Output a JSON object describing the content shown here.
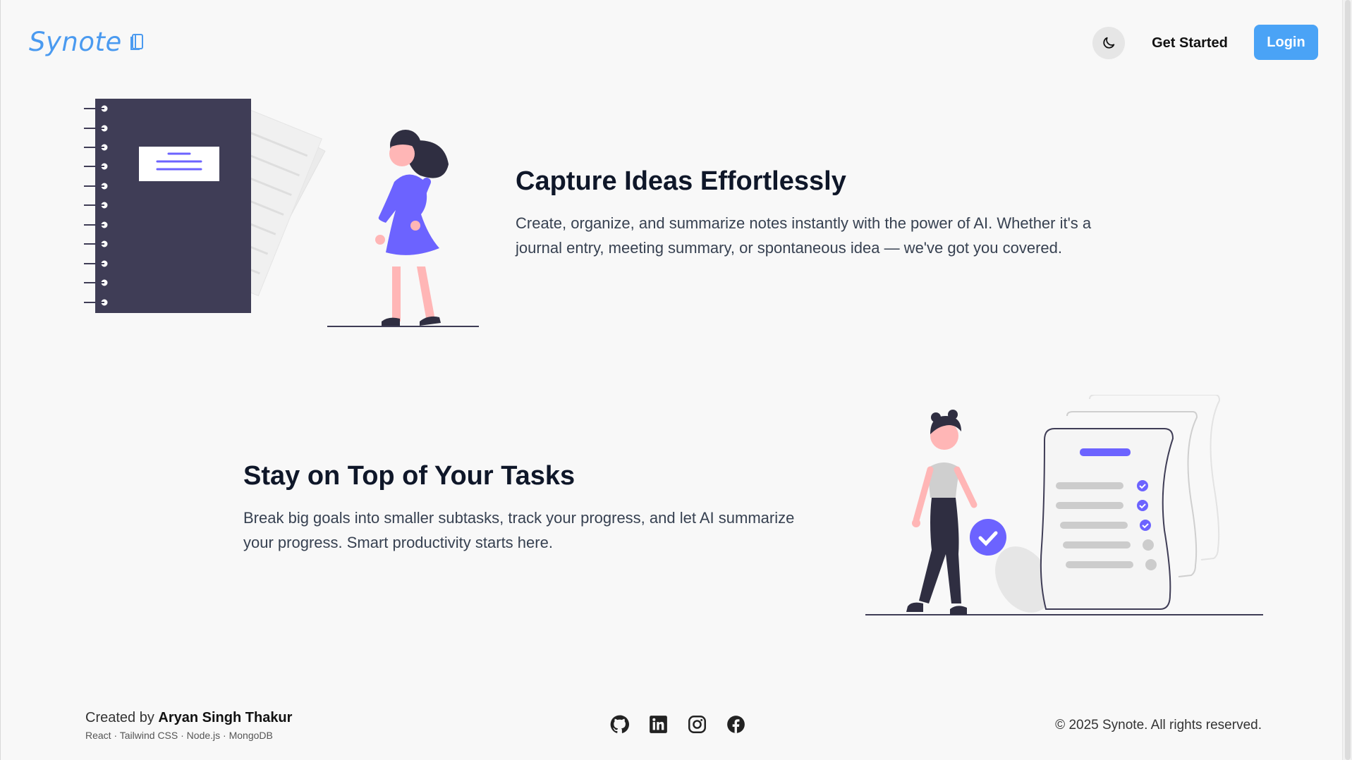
{
  "header": {
    "logo_text": "Synote",
    "get_started_label": "Get Started",
    "login_label": "Login"
  },
  "sections": [
    {
      "title": "Capture Ideas Effortlessly",
      "text": "Create, organize, and summarize notes instantly with the power of AI. Whether it's a journal entry, meeting summary, or spontaneous idea — we've got you covered."
    },
    {
      "title": "Stay on Top of Your Tasks",
      "text": "Break big goals into smaller subtasks, track your progress, and let AI summarize your progress. Smart productivity starts here."
    }
  ],
  "footer": {
    "created_by_prefix": "Created by",
    "author": "Aryan Singh Thakur",
    "stack": "React · Tailwind CSS · Node.js · MongoDB",
    "copyright": "© 2025 Synote. All rights reserved.",
    "social_icons": [
      "github-icon",
      "linkedin-icon",
      "instagram-icon",
      "facebook-icon"
    ]
  },
  "colors": {
    "accent": "#4aa3f6",
    "illustration_purple": "#6c63ff",
    "illustration_dark": "#3f3d56",
    "skin": "#ffb6b6"
  }
}
